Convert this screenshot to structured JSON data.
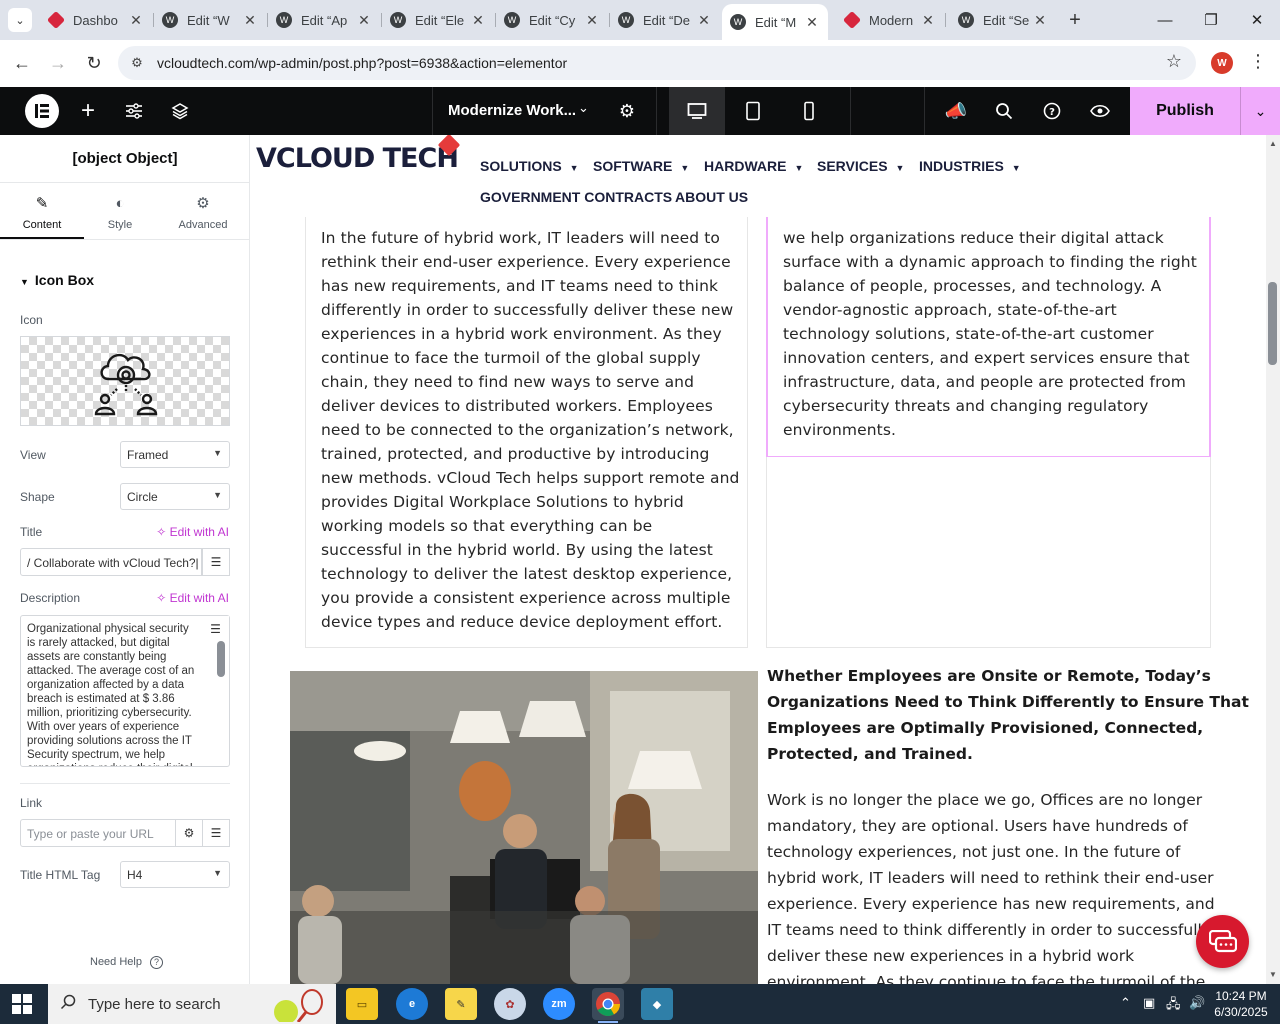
{
  "browser": {
    "tabs": [
      {
        "title": "Dashbo",
        "active": false
      },
      {
        "title": "Edit “W",
        "active": false
      },
      {
        "title": "Edit “Ap",
        "active": false
      },
      {
        "title": "Edit “Ele",
        "active": false
      },
      {
        "title": "Edit “Cy",
        "active": false
      },
      {
        "title": "Edit “De",
        "active": false
      },
      {
        "title": "Edit “M",
        "active": true
      },
      {
        "title": "Modern",
        "active": false
      },
      {
        "title": "Edit “Se",
        "active": false
      }
    ],
    "url": "vcloudtech.com/wp-admin/post.php?post=6938&action=elementor",
    "profile_initial": "W"
  },
  "elementor_bar": {
    "document_title": "Modernize Work...",
    "publish_label": "Publish"
  },
  "panel": {
    "title": {
      "label": "Title",
      "ai": "Edit with AI",
      "value": "/ Collaborate with vCloud Tech?|"
    },
    "tabs": [
      {
        "label": "Content",
        "icon": "pencil-icon",
        "active": true
      },
      {
        "label": "Style",
        "icon": "half-circle-icon",
        "active": false
      },
      {
        "label": "Advanced",
        "icon": "gear-icon",
        "active": false
      }
    ],
    "section": "Icon Box",
    "icon_label": "Icon",
    "view": {
      "label": "View",
      "value": "Framed"
    },
    "shape": {
      "label": "Shape",
      "value": "Circle"
    },
    "description": {
      "label": "Description",
      "ai": "Edit with AI",
      "value": "Organizational physical security is rarely attacked, but digital assets are constantly being attacked. The average cost of an organization affected by a data breach is estimated at $ 3.86 million, prioritizing cybersecurity. With over years of experience providing solutions across the IT Security spectrum, we help organizations reduce their digital"
    },
    "link": {
      "label": "Link",
      "placeholder": "Type or paste your URL"
    },
    "title_tag": {
      "label": "Title HTML Tag",
      "value": "H4"
    },
    "need_help": "Need Help"
  },
  "site": {
    "logo": "VCLOUD TECH",
    "nav": [
      {
        "label": "SOLUTIONS",
        "dropdown": true
      },
      {
        "label": "SOFTWARE",
        "dropdown": true
      },
      {
        "label": "HARDWARE",
        "dropdown": true
      },
      {
        "label": "SERVICES",
        "dropdown": true
      },
      {
        "label": "INDUSTRIES",
        "dropdown": true
      },
      {
        "label": "GOVERNMENT CONTRACTS",
        "dropdown": false
      },
      {
        "label": "ABOUT US",
        "dropdown": false
      }
    ],
    "left_card_lines": [
      "In the future of hybrid work, IT leaders will need to",
      "rethink their end-user experience. Every experience",
      "has new requirements, and IT teams need to think",
      "differently in order to successfully deliver these new",
      "experiences in a hybrid work environment. As they",
      "continue to face the turmoil of the global supply",
      "chain, they need to find new ways to serve and",
      "deliver devices to distributed workers. Employees",
      "need to be connected to the organization’s network,",
      "trained, protected, and productive by introducing",
      "new methods. vCloud Tech helps support remote and",
      "provides Digital Workplace Solutions to hybrid",
      "working models so that everything can be",
      "successful in the hybrid world. By using the latest",
      "technology to deliver the latest desktop experience,",
      "you provide a consistent experience across multiple",
      "device types and reduce device deployment effort."
    ],
    "right_card_lines": [
      "we help organizations reduce their digital attack",
      "surface with a dynamic approach to finding the right",
      "balance of people, processes, and technology. A",
      "vendor-agnostic approach, state-of-the-art",
      "technology solutions, state-of-the-art customer",
      "innovation centers, and expert services ensure that",
      "infrastructure, data, and people are protected from",
      "cybersecurity threats and changing regulatory",
      "environments."
    ],
    "heading_lines": [
      "Whether Employees are Onsite or Remote, Today’s",
      "Organizations Need to Think Differently to Ensure That",
      "Employees are Optimally Provisioned, Connected,",
      "Protected, and Trained."
    ],
    "para_lines": [
      "Work is no longer the place we go, Offices are no longer",
      "mandatory, they are optional. Users have hundreds of",
      "technology experiences, not just one.  In the future of",
      "hybrid work, IT leaders will need to rethink their end-user",
      "experience. Every experience has new requirements, and",
      "IT teams need to think differently in order to successfully",
      "deliver these new experiences in a hybrid work",
      "environment. As they continue to face the turmoil of the"
    ]
  },
  "taskbar": {
    "search_placeholder": "Type here to search",
    "time": "10:24 PM",
    "date": "6/30/2025",
    "apps": [
      "file-explorer-icon",
      "edge-icon",
      "sticky-notes-icon",
      "paint-icon",
      "zoom-icon",
      "chrome-icon",
      "app-icon"
    ]
  },
  "colors": {
    "publish": "#f0abfc",
    "accent_pink": "#c036d1",
    "chat": "#d7192e",
    "brand_navy": "#1b1f3b",
    "logo_red": "#e53b3b"
  }
}
